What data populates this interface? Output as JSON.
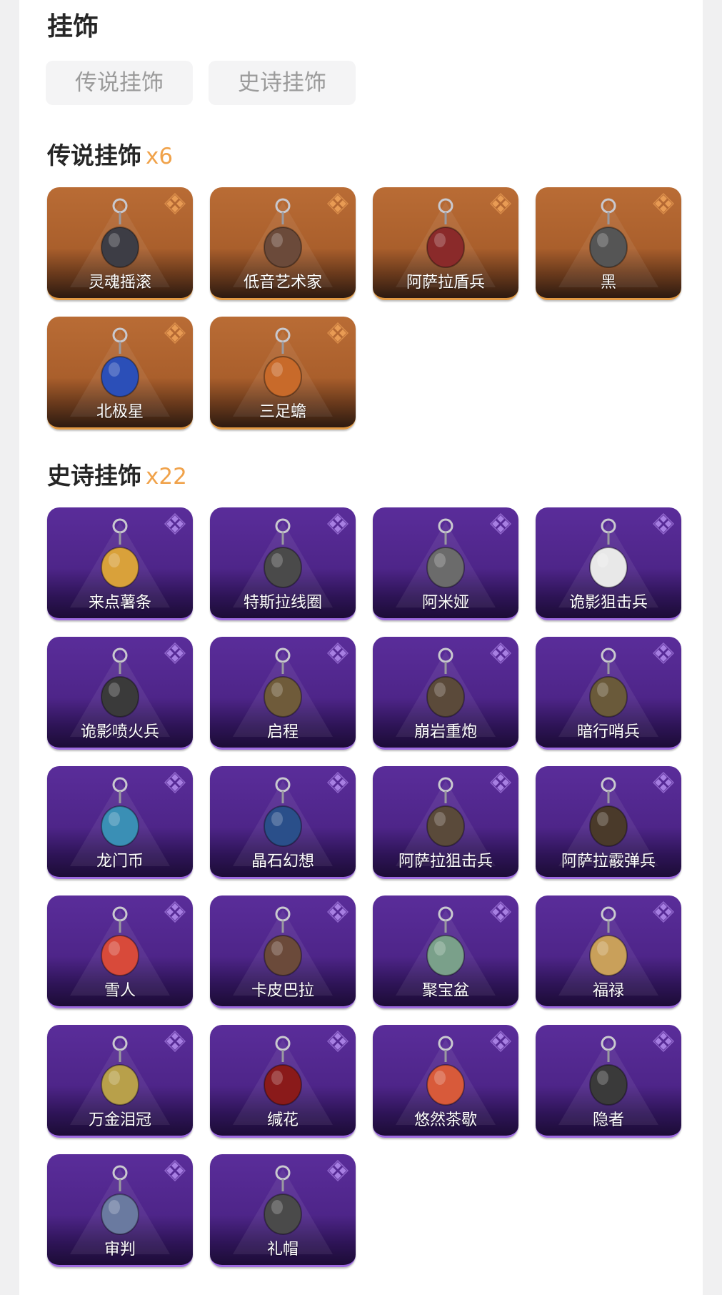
{
  "page": {
    "title": "挂饰"
  },
  "filters": [
    {
      "label": "传说挂饰"
    },
    {
      "label": "史诗挂饰"
    }
  ],
  "sections": {
    "legendary": {
      "title": "传说挂饰",
      "count": "x6",
      "accent": "#f0a24a",
      "items": [
        {
          "name": "灵魂摇滚"
        },
        {
          "name": "低音艺术家"
        },
        {
          "name": "阿萨拉盾兵"
        },
        {
          "name": "黑"
        },
        {
          "name": "北极星"
        },
        {
          "name": "三足蟾"
        }
      ]
    },
    "epic": {
      "title": "史诗挂饰",
      "count": "x22",
      "accent": "#9d6ae0",
      "items": [
        {
          "name": "来点薯条"
        },
        {
          "name": "特斯拉线圈"
        },
        {
          "name": "阿米娅"
        },
        {
          "name": "诡影狙击兵"
        },
        {
          "name": "诡影喷火兵"
        },
        {
          "name": "启程"
        },
        {
          "name": "崩岩重炮"
        },
        {
          "name": "暗行哨兵"
        },
        {
          "name": "龙门币"
        },
        {
          "name": "晶石幻想"
        },
        {
          "name": "阿萨拉狙击兵"
        },
        {
          "name": "阿萨拉霰弹兵"
        },
        {
          "name": "雪人"
        },
        {
          "name": "卡皮巴拉"
        },
        {
          "name": "聚宝盆"
        },
        {
          "name": "福禄"
        },
        {
          "name": "万金泪冠"
        },
        {
          "name": "缄花"
        },
        {
          "name": "悠然茶歇"
        },
        {
          "name": "隐者"
        },
        {
          "name": "审判"
        },
        {
          "name": "礼帽"
        }
      ]
    }
  }
}
